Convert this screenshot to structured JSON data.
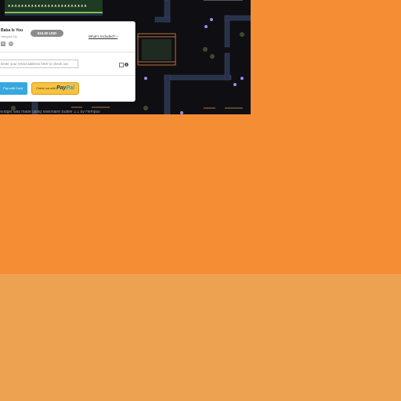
{
  "widget": {
    "product_name": "Baba Is You",
    "author": "Hempuli Oy",
    "price": "$15.00 USD",
    "whats_included": "What's Included?",
    "email_placeholder": "Enter your email address here to check out",
    "card_button": "Pay with Card",
    "paypal_button_prefix": "Check out with",
    "paypal_logo_main": "Pay",
    "paypal_logo_tail": "Pal"
  },
  "game": {
    "title_text": "ᴥᴥᴥᴥᴥᴥᴥᴥᴥᴥᴥᴥᴥᴥᴥᴥᴥᴥᴥᴥᴥᴥᴥᴥ"
  },
  "footer": {
    "text": "Widget was made using Millionaire Buttler 2.1 by Hempuli"
  },
  "icons": {
    "platforms": [
      "windows-icon",
      "steam-icon"
    ],
    "chevron": "chevron-right-icon",
    "info": "info-icon"
  },
  "colors": {
    "background_top": "#f58d34",
    "background_bottom": "#eda252",
    "price_badge": "#8c8c8c",
    "card_button": "#36a8de",
    "paypal_button": "#f8c33a"
  }
}
